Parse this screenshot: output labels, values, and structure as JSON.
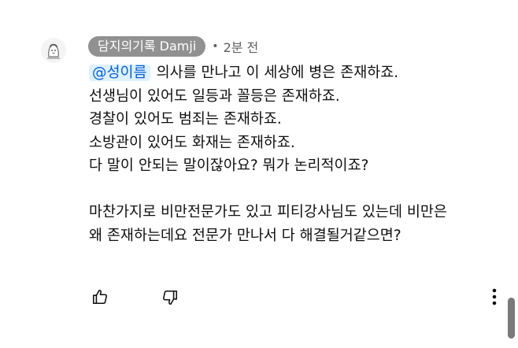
{
  "comment": {
    "author": "담지의기록 Damji",
    "separator": "•",
    "timestamp": "2분 전",
    "mention": "@성이름",
    "first_line_rest": "의사를 만나고 이 세상에 병은 존재하죠.",
    "lines": [
      "선생님이 있어도 일등과 꼴등은 존재하죠.",
      "경찰이 있어도 범죄는 존재하죠.",
      "소방관이 있어도 화재는 존재하죠.",
      "다 말이 안되는 말이잖아요? 뭐가 논리적이죠?",
      "",
      "마찬가지로 비만전문가도 있고 피티강사님도 있는데 비만은",
      "왜 존재하는데요 전문가 만나서 다 해결될거같으면?"
    ]
  },
  "icons": {
    "avatar": "avatar-doodle",
    "like": "thumbs-up-icon",
    "dislike": "thumbs-down-icon",
    "more": "more-vertical-icon"
  },
  "colors": {
    "author_chip": "#919191",
    "mention_text": "#065fd4",
    "mention_bg": "#def1ff",
    "meta_text": "#606060",
    "body_text": "#0f0f0f",
    "scrollbar": "#7a7a7a"
  }
}
